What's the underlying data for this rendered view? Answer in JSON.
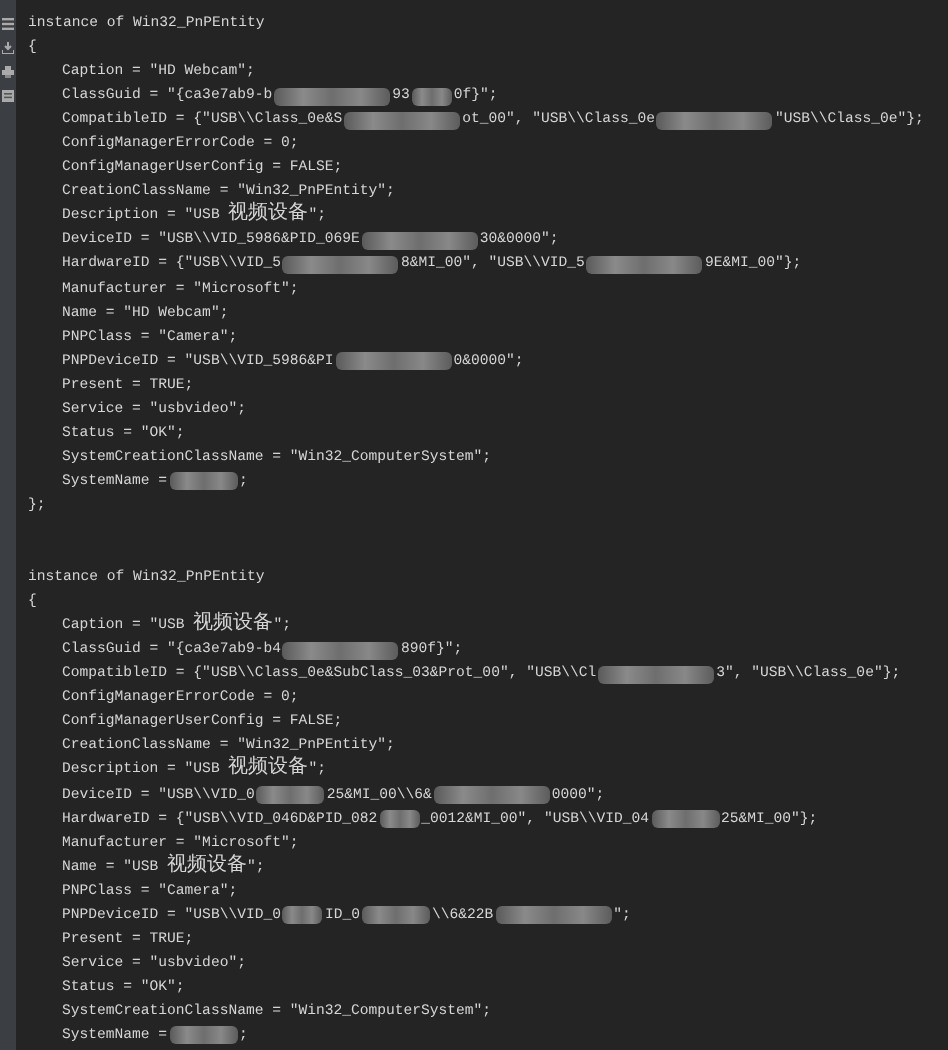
{
  "instances": [
    {
      "header": [
        {
          "kind": "text",
          "text": "instance of Win32_PnPEntity"
        }
      ],
      "open_brace": "{",
      "close_brace": "};",
      "properties": [
        [
          {
            "kind": "text",
            "text": "Caption = \"HD Webcam\";"
          }
        ],
        [
          {
            "kind": "text",
            "text": "ClassGuid = \"{ca3e7ab9-b"
          },
          {
            "kind": "redacted_long"
          },
          {
            "kind": "text",
            "text": "93"
          },
          {
            "kind": "redacted_short"
          },
          {
            "kind": "text",
            "text": "0f}\";"
          }
        ],
        [
          {
            "kind": "text",
            "text": "CompatibleID = {\"USB\\\\Class_0e&S"
          },
          {
            "kind": "redacted_long"
          },
          {
            "kind": "text",
            "text": "ot_00\", \"USB\\\\Class_0e"
          },
          {
            "kind": "redacted_long"
          },
          {
            "kind": "text",
            "text": "\"USB\\\\Class_0e\"};"
          }
        ],
        [
          {
            "kind": "text",
            "text": "ConfigManagerErrorCode = 0;"
          }
        ],
        [
          {
            "kind": "text",
            "text": "ConfigManagerUserConfig = FALSE;"
          }
        ],
        [
          {
            "kind": "text",
            "text": "CreationClassName = \"Win32_PnPEntity\";"
          }
        ],
        [
          {
            "kind": "text",
            "text": "Description = \"USB 视频设备\";"
          }
        ],
        [
          {
            "kind": "text",
            "text": "DeviceID = \"USB\\\\VID_5986&PID_069E"
          },
          {
            "kind": "redacted_long"
          },
          {
            "kind": "text",
            "text": "30&0000\";"
          }
        ],
        [
          {
            "kind": "text",
            "text": "HardwareID = {\"USB\\\\VID_5"
          },
          {
            "kind": "redacted_long"
          },
          {
            "kind": "text",
            "text": "8&MI_00\", \"USB\\\\VID_5"
          },
          {
            "kind": "redacted_long"
          },
          {
            "kind": "text",
            "text": "9E&MI_00\"};"
          }
        ],
        [
          {
            "kind": "text",
            "text": "Manufacturer = \"Microsoft\";"
          }
        ],
        [
          {
            "kind": "text",
            "text": "Name = \"HD Webcam\";"
          }
        ],
        [
          {
            "kind": "text",
            "text": "PNPClass = \"Camera\";"
          }
        ],
        [
          {
            "kind": "text",
            "text": "PNPDeviceID = \"USB\\\\VID_5986&PI"
          },
          {
            "kind": "redacted_long"
          },
          {
            "kind": "text",
            "text": "0&0000\";"
          }
        ],
        [
          {
            "kind": "text",
            "text": "Present = TRUE;"
          }
        ],
        [
          {
            "kind": "text",
            "text": "Service = \"usbvideo\";"
          }
        ],
        [
          {
            "kind": "text",
            "text": "Status = \"OK\";"
          }
        ],
        [
          {
            "kind": "text",
            "text": "SystemCreationClassName = \"Win32_ComputerSystem\";"
          }
        ],
        [
          {
            "kind": "text",
            "text": "SystemName ="
          },
          {
            "kind": "redacted_medium"
          },
          {
            "kind": "text",
            "text": ";"
          }
        ]
      ]
    },
    {
      "header": [
        {
          "kind": "text",
          "text": "instance of Win32_PnPEntity"
        }
      ],
      "open_brace": "{",
      "properties": [
        [
          {
            "kind": "text",
            "text": "Caption = \"USB 视频设备\";"
          }
        ],
        [
          {
            "kind": "text",
            "text": "ClassGuid = \"{ca3e7ab9-b4"
          },
          {
            "kind": "redacted_long"
          },
          {
            "kind": "text",
            "text": "890f}\";"
          }
        ],
        [
          {
            "kind": "text",
            "text": "CompatibleID = {\"USB\\\\Class_0e&SubClass_03&Prot_00\", \"USB\\\\Cl"
          },
          {
            "kind": "redacted_long"
          },
          {
            "kind": "text",
            "text": "3\", \"USB\\\\Class_0e\"};"
          }
        ],
        [
          {
            "kind": "text",
            "text": "ConfigManagerErrorCode = 0;"
          }
        ],
        [
          {
            "kind": "text",
            "text": "ConfigManagerUserConfig = FALSE;"
          }
        ],
        [
          {
            "kind": "text",
            "text": "CreationClassName = \"Win32_PnPEntity\";"
          }
        ],
        [
          {
            "kind": "text",
            "text": "Description = \"USB 视频设备\";"
          }
        ],
        [
          {
            "kind": "text",
            "text": "DeviceID = \"USB\\\\VID_0"
          },
          {
            "kind": "redacted_medium"
          },
          {
            "kind": "text",
            "text": "25&MI_00\\\\6&"
          },
          {
            "kind": "redacted_long"
          },
          {
            "kind": "text",
            "text": "0000\";"
          }
        ],
        [
          {
            "kind": "text",
            "text": "HardwareID = {\"USB\\\\VID_046D&PID_082"
          },
          {
            "kind": "redacted_short"
          },
          {
            "kind": "text",
            "text": "_0012&MI_00\", \"USB\\\\VID_04"
          },
          {
            "kind": "redacted_medium"
          },
          {
            "kind": "text",
            "text": "25&MI_00\"};"
          }
        ],
        [
          {
            "kind": "text",
            "text": "Manufacturer = \"Microsoft\";"
          }
        ],
        [
          {
            "kind": "text",
            "text": "Name = \"USB 视频设备\";"
          }
        ],
        [
          {
            "kind": "text",
            "text": "PNPClass = \"Camera\";"
          }
        ],
        [
          {
            "kind": "text",
            "text": "PNPDeviceID = \"USB\\\\VID_0"
          },
          {
            "kind": "redacted_short"
          },
          {
            "kind": "text",
            "text": "ID_0"
          },
          {
            "kind": "redacted_medium"
          },
          {
            "kind": "text",
            "text": "\\\\6&22B"
          },
          {
            "kind": "redacted_long"
          },
          {
            "kind": "text",
            "text": "\";"
          }
        ],
        [
          {
            "kind": "text",
            "text": "Present = TRUE;"
          }
        ],
        [
          {
            "kind": "text",
            "text": "Service = \"usbvideo\";"
          }
        ],
        [
          {
            "kind": "text",
            "text": "Status = \"OK\";"
          }
        ],
        [
          {
            "kind": "text",
            "text": "SystemCreationClassName = \"Win32_ComputerSystem\";"
          }
        ],
        [
          {
            "kind": "text",
            "text": "SystemName ="
          },
          {
            "kind": "redacted_medium"
          },
          {
            "kind": "text",
            "text": ";"
          }
        ]
      ]
    }
  ]
}
